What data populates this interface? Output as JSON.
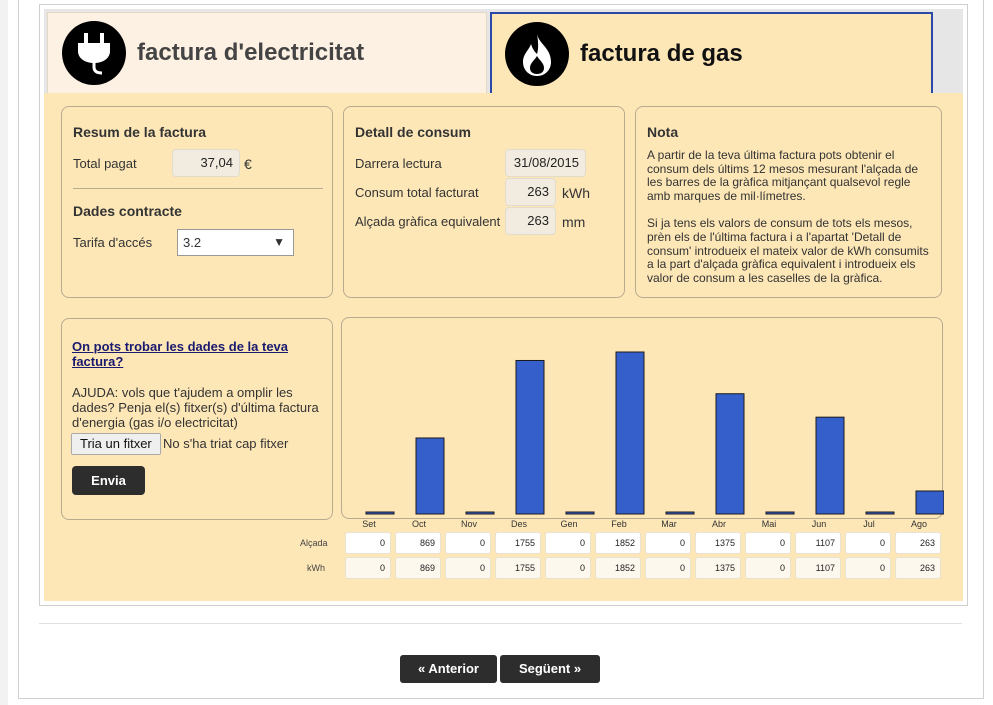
{
  "tabs": {
    "electricity": {
      "label": "factura d'electricitat",
      "icon": "plug-icon"
    },
    "gas": {
      "label": "factura de gas",
      "icon": "flame-icon"
    }
  },
  "summary": {
    "title": "Resum de la factura",
    "total_label": "Total pagat",
    "total_value": "37,04",
    "total_unit": "€",
    "contract_title": "Dades contracte",
    "tariff_label": "Tarifa d'accés",
    "tariff_value": "3.2"
  },
  "detail": {
    "title": "Detall de consum",
    "last_reading_label": "Darrera lectura",
    "last_reading_value": "31/08/2015",
    "total_consumption_label": "Consum total facturat",
    "total_consumption_value": "263",
    "total_consumption_unit": "kWh",
    "height_label": "Alçada gràfica equivalent",
    "height_value": "263",
    "height_unit": "mm"
  },
  "note": {
    "title": "Nota",
    "paragraph1": "A partir de la teva última factura pots obtenir el consum dels últims 12 mesos mesurant l'alçada de les barres de la gràfica mitjançant qualsevol regle amb marques de mil·límetres.",
    "paragraph2": "Si ja tens els valors de consum de tots els mesos, prèn els de l'última factura i a l'apartat 'Detall de consum' introdueix el mateix valor de kWh consumits a la part d'alçada gràfica equivalent i introdueix els valor de consum a les caselles de la gràfica."
  },
  "help": {
    "link": "On pots trobar les dades de la teva factura?",
    "text": "AJUDA: vols que t'ajudem a omplir les dades? Penja el(s) fitxer(s) d'última factura d'energia (gas i/o electricitat)",
    "file_button": "Tria un fitxer",
    "file_status": "No s'ha triat cap fitxer",
    "send_button": "Envia"
  },
  "table": {
    "height_row_label": "Alçada",
    "kwh_row_label": "kWh"
  },
  "chart_data": {
    "type": "bar",
    "categories": [
      "Set",
      "Oct",
      "Nov",
      "Des",
      "Gen",
      "Feb",
      "Mar",
      "Abr",
      "Mai",
      "Jun",
      "Jul",
      "Ago"
    ],
    "series": [
      {
        "values": [
          0,
          869,
          0,
          1755,
          0,
          1852,
          0,
          1375,
          0,
          1107,
          0,
          263
        ]
      }
    ],
    "kwh": [
      0,
      869,
      0,
      1755,
      0,
      1852,
      0,
      1375,
      0,
      1107,
      0,
      263
    ],
    "ylim": [
      0,
      1852
    ],
    "bar_color": "#3560cc",
    "grid": false
  },
  "nav": {
    "previous": "« Anterior",
    "next": "Següent »"
  },
  "colors": {
    "panel_bg": "#fde7b7",
    "active_tab_border": "#2b4aa8",
    "button_dark": "#2d2d2d"
  }
}
